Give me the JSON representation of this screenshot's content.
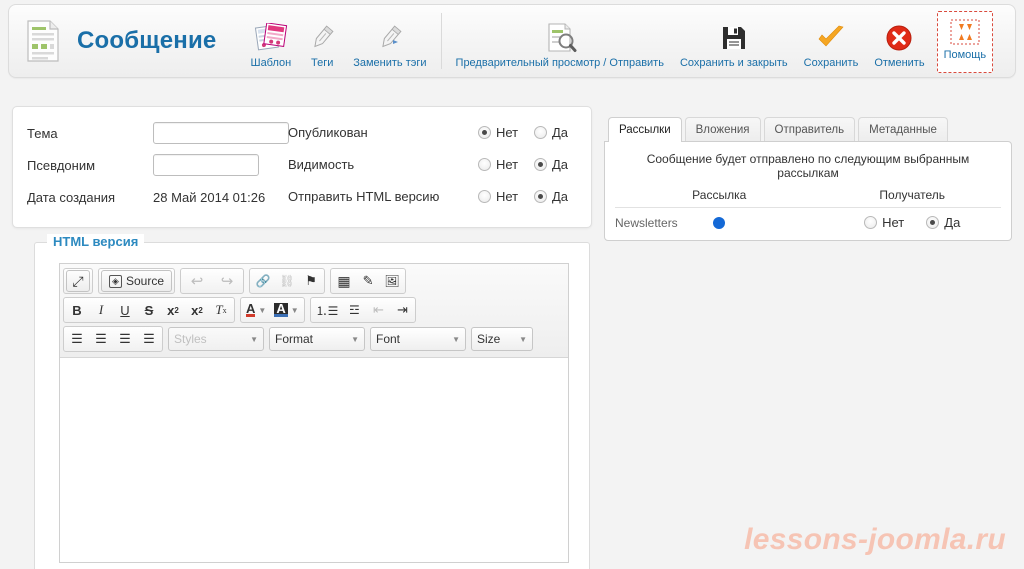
{
  "header": {
    "doc_icon": "document-icon",
    "title": "Сообщение",
    "buttons": [
      {
        "label": "Шаблон",
        "icon": "template-icon"
      },
      {
        "label": "Теги",
        "icon": "tag-icon"
      },
      {
        "label": "Заменить тэги",
        "icon": "replace-tags-icon"
      },
      {
        "label": "Предварительный просмотр / Отправить",
        "icon": "preview-send-icon"
      },
      {
        "label": "Сохранить и закрыть",
        "icon": "save-close-icon"
      },
      {
        "label": "Сохранить",
        "icon": "checkmark-icon"
      },
      {
        "label": "Отменить",
        "icon": "cancel-icon"
      },
      {
        "label": "Помощь",
        "icon": "broken-image-icon"
      }
    ]
  },
  "details": {
    "subject": {
      "label": "Тема",
      "value": "",
      "placeholder": ""
    },
    "alias": {
      "label": "Псевдоним",
      "value": "",
      "placeholder": ""
    },
    "created": {
      "label": "Дата создания",
      "value": "28 Май 2014 01:26"
    }
  },
  "options": {
    "yes_label": "Да",
    "no_label": "Нет",
    "rows": [
      {
        "label": "Опубликован",
        "selected": "no"
      },
      {
        "label": "Видимость",
        "selected": "yes"
      },
      {
        "label": "Отправить HTML версию",
        "selected": "yes"
      }
    ]
  },
  "right_panel": {
    "tabs": [
      {
        "label": "Рассылки",
        "active": true
      },
      {
        "label": "Вложения",
        "active": false
      },
      {
        "label": "Отправитель",
        "active": false
      },
      {
        "label": "Метаданные",
        "active": false
      }
    ],
    "note": "Сообщение будет отправлено по следующим выбранным рассылкам",
    "columns": [
      "Рассылка",
      "Получатель"
    ],
    "rows": [
      {
        "name": "Newsletters",
        "status_color": "#1469d6",
        "receiver": "yes"
      }
    ],
    "yes_label": "Да",
    "no_label": "Нет"
  },
  "editor": {
    "legend": "HTML версия",
    "toolbar_row1": [
      {
        "name": "maximize",
        "glyph": "⤢"
      },
      {
        "name": "source",
        "glyph": "◧",
        "label": "Source"
      },
      {
        "name": "undo",
        "glyph": "↩"
      },
      {
        "name": "redo",
        "glyph": "↪"
      },
      {
        "name": "link",
        "glyph": "🔗"
      },
      {
        "name": "unlink",
        "glyph": "⛓"
      },
      {
        "name": "anchor",
        "glyph": "⚑"
      },
      {
        "name": "table",
        "glyph": "▦"
      },
      {
        "name": "pencil",
        "glyph": "✎"
      },
      {
        "name": "image",
        "glyph": "🖼"
      }
    ],
    "toolbar_row2": [
      {
        "name": "bold",
        "glyph": "B"
      },
      {
        "name": "italic",
        "glyph": "I"
      },
      {
        "name": "underline",
        "glyph": "U"
      },
      {
        "name": "strike",
        "glyph": "S"
      },
      {
        "name": "subscript",
        "glyph": "x"
      },
      {
        "name": "superscript",
        "glyph": "x"
      },
      {
        "name": "remove-format",
        "glyph": "Tx"
      },
      {
        "name": "text-color",
        "glyph": "A"
      },
      {
        "name": "background-color",
        "glyph": "A"
      },
      {
        "name": "numbered-list",
        "glyph": "≡"
      },
      {
        "name": "bulleted-list",
        "glyph": "≔"
      },
      {
        "name": "outdent",
        "glyph": "⇤"
      },
      {
        "name": "indent",
        "glyph": "⇥"
      }
    ],
    "toolbar_row3": [
      {
        "name": "align-left",
        "glyph": "≡"
      },
      {
        "name": "align-center",
        "glyph": "≡"
      },
      {
        "name": "align-right",
        "glyph": "≡"
      },
      {
        "name": "justify",
        "glyph": "≡"
      }
    ],
    "combos": [
      {
        "name": "styles",
        "label": "Styles",
        "disabled": true
      },
      {
        "name": "format",
        "label": "Format",
        "disabled": false
      },
      {
        "name": "font",
        "label": "Font",
        "disabled": false
      },
      {
        "name": "size",
        "label": "Size",
        "disabled": false
      }
    ],
    "content": ""
  },
  "watermark": {
    "text": "lessons-joomla.ru",
    "color": "#f6c4b4"
  }
}
